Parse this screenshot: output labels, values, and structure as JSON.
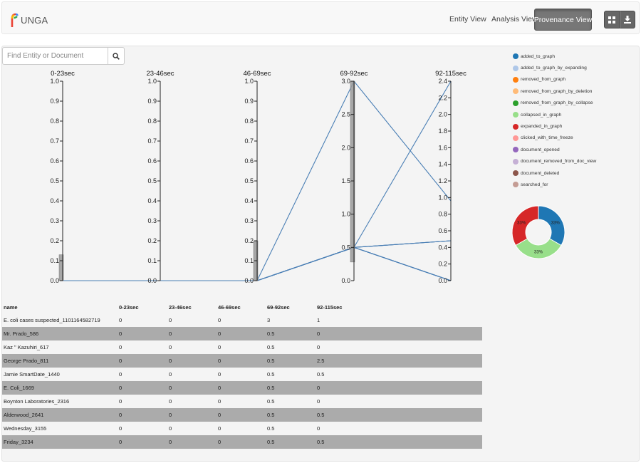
{
  "app": {
    "brand": "UNGA"
  },
  "nav": {
    "entity_view": "Entity View",
    "analysis_view": "Analysis View",
    "provenance_view": "Provenance View"
  },
  "toolbar": {
    "grid_icon": "grid-icon",
    "download_icon": "download-icon"
  },
  "search": {
    "placeholder": "Find Entity or Document",
    "icon": "search-icon"
  },
  "legend": [
    {
      "label": "added_to_graph",
      "color": "#1f77b4"
    },
    {
      "label": "added_to_graph_by_expanding",
      "color": "#aec7e8"
    },
    {
      "label": "removed_from_graph",
      "color": "#ff7f0e"
    },
    {
      "label": "removed_from_graph_by_deletion",
      "color": "#ffbb78"
    },
    {
      "label": "removed_from_graph_by_collapse",
      "color": "#2ca02c"
    },
    {
      "label": "collapsed_in_graph",
      "color": "#98df8a"
    },
    {
      "label": "expanded_in_graph",
      "color": "#d62728"
    },
    {
      "label": "clicked_with_time_freeze",
      "color": "#ff9896"
    },
    {
      "label": "document_opened",
      "color": "#9467bd"
    },
    {
      "label": "document_removed_from_doc_view",
      "color": "#c5b0d5"
    },
    {
      "label": "document_deleted",
      "color": "#8c564b"
    },
    {
      "label": "searched_for",
      "color": "#c49c94"
    }
  ],
  "chart_data": [
    {
      "type": "parallel-coordinates",
      "axes": [
        {
          "label": "0-23sec",
          "domain": [
            0,
            1.0
          ],
          "ticks": [
            "0.0",
            "0.1",
            "0.2",
            "0.3",
            "0.4",
            "0.5",
            "0.6",
            "0.7",
            "0.8",
            "0.9",
            "1.0"
          ],
          "brush": [
            0,
            0.13
          ]
        },
        {
          "label": "23-46sec",
          "domain": [
            0,
            1.0
          ],
          "ticks": [
            "0.0",
            "0.1",
            "0.2",
            "0.3",
            "0.4",
            "0.5",
            "0.6",
            "0.7",
            "0.8",
            "0.9",
            "1.0"
          ]
        },
        {
          "label": "46-69sec",
          "domain": [
            0,
            1.0
          ],
          "ticks": [
            "0.0",
            "0.1",
            "0.2",
            "0.3",
            "0.4",
            "0.5",
            "0.6",
            "0.7",
            "0.8",
            "0.9",
            "1.0"
          ],
          "brush": [
            0,
            0.2
          ]
        },
        {
          "label": "69-92sec",
          "domain": [
            0,
            3.0
          ],
          "ticks": [
            "0.0",
            "0.5",
            "1.0",
            "1.5",
            "2.0",
            "2.5",
            "3.0"
          ],
          "brush": [
            0.28,
            3.0
          ]
        },
        {
          "label": "92-115sec",
          "domain": [
            0,
            2.5
          ],
          "ticks": [
            "0.0",
            "0.2",
            "0.4",
            "0.6",
            "0.8",
            "1.0",
            "1.2",
            "1.4",
            "1.6",
            "1.8",
            "2.0",
            "2.2",
            "2.4"
          ]
        }
      ],
      "line_color": "#4a7fb5",
      "columns": [
        "name",
        "0-23sec",
        "23-46sec",
        "46-69sec",
        "69-92sec",
        "92-115sec"
      ],
      "rows": [
        [
          "E. coli cases suspected_1101164582719",
          "0",
          "0",
          "0",
          "3",
          "1"
        ],
        [
          "Mr. Prado_586",
          "0",
          "0",
          "0",
          "0.5",
          "0"
        ],
        [
          "Kaz \" Kazuhiri_617",
          "0",
          "0",
          "0",
          "0.5",
          "0"
        ],
        [
          "George Prado_811",
          "0",
          "0",
          "0",
          "0.5",
          "2.5"
        ],
        [
          "Jamie SmartDate_1440",
          "0",
          "0",
          "0",
          "0.5",
          "0.5"
        ],
        [
          "E. Coli_1669",
          "0",
          "0",
          "0",
          "0.5",
          "0"
        ],
        [
          "Boynton Laboratories_2316",
          "0",
          "0",
          "0",
          "0.5",
          "0"
        ],
        [
          "Alderwood_2641",
          "0",
          "0",
          "0",
          "0.5",
          "0.5"
        ],
        [
          "Wednesday_3155",
          "0",
          "0",
          "0",
          "0.5",
          "0"
        ],
        [
          "Friday_3234",
          "0",
          "0",
          "0",
          "0.5",
          "0.5"
        ]
      ]
    },
    {
      "type": "pie",
      "variant": "donut",
      "slices": [
        {
          "label": "added_to_graph",
          "value": 33,
          "text": "33%",
          "color": "#1f77b4"
        },
        {
          "label": "collapsed_in_graph",
          "value": 33,
          "text": "33%",
          "color": "#98df8a"
        },
        {
          "label": "expanded_in_graph",
          "value": 33,
          "text": "33%",
          "color": "#d62728"
        }
      ]
    }
  ]
}
